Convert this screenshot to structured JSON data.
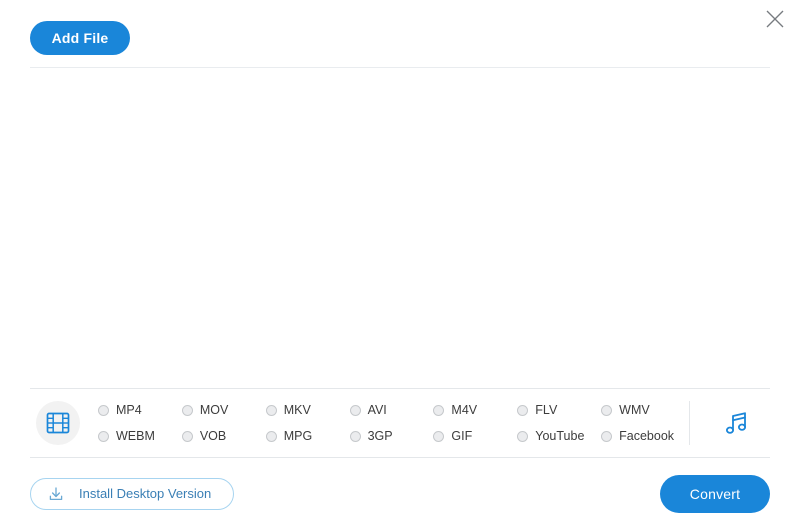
{
  "window": {
    "close_label": "Close",
    "close_icon": "close-icon"
  },
  "toolbar": {
    "add_file_label": "Add File"
  },
  "main": {
    "file_list_empty": ""
  },
  "format_panel": {
    "video_icon": "film-strip-icon",
    "audio_icon": "music-note-icon",
    "columns": 7,
    "options": [
      {
        "label": "MP4",
        "selected": false
      },
      {
        "label": "MOV",
        "selected": false
      },
      {
        "label": "MKV",
        "selected": false
      },
      {
        "label": "AVI",
        "selected": false
      },
      {
        "label": "M4V",
        "selected": false
      },
      {
        "label": "FLV",
        "selected": false
      },
      {
        "label": "WMV",
        "selected": false
      },
      {
        "label": "WEBM",
        "selected": false
      },
      {
        "label": "VOB",
        "selected": false
      },
      {
        "label": "MPG",
        "selected": false
      },
      {
        "label": "3GP",
        "selected": false
      },
      {
        "label": "GIF",
        "selected": false
      },
      {
        "label": "YouTube",
        "selected": false
      },
      {
        "label": "Facebook",
        "selected": false
      }
    ]
  },
  "footer": {
    "install_label": "Install Desktop Version",
    "install_icon": "download-icon",
    "convert_label": "Convert"
  },
  "colors": {
    "accent": "#1a86d9",
    "panel_border": "#e4e7ea",
    "radio_border": "#c6c9cc",
    "install_border": "#a7d4f0",
    "install_text": "#3a7fb5"
  }
}
